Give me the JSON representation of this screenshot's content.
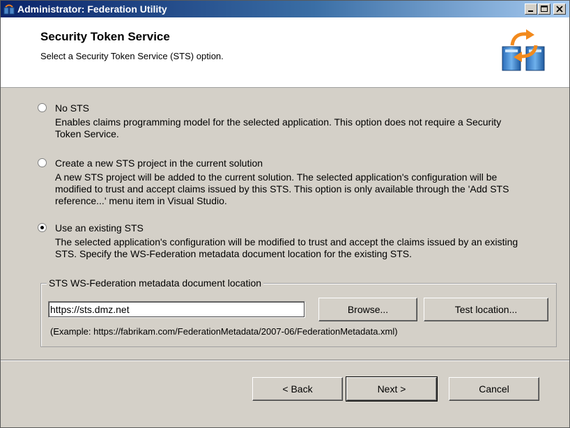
{
  "window": {
    "title": "Administrator: Federation Utility"
  },
  "header": {
    "title": "Security Token Service",
    "subtitle": "Select a Security Token Service (STS) option.",
    "icon": "federation-servers-sync-icon"
  },
  "options": [
    {
      "label": "No STS",
      "description": "Enables claims programming model for the selected application. This option does not require a Security Token Service.",
      "selected": false
    },
    {
      "label": "Create a new STS project in the current solution",
      "description": "A new STS project will be added to the current solution. The selected application's configuration will be modified to trust and accept claims issued by this STS. This option is only available through the 'Add STS reference...' menu item in Visual Studio.",
      "selected": false
    },
    {
      "label": "Use an existing STS",
      "description": "The selected application's configuration will be modified to trust and accept the claims issued by an existing STS. Specify the WS-Federation metadata document location for the existing STS.",
      "selected": true
    }
  ],
  "metadata": {
    "group_label": "STS WS-Federation metadata document location",
    "value": "https://sts.dmz.net",
    "browse_label": "Browse...",
    "test_label": "Test location...",
    "example": "(Example: https://fabrikam.com/FederationMetadata/2007-06/FederationMetadata.xml)"
  },
  "footer": {
    "back_label": "< Back",
    "next_label": "Next >",
    "cancel_label": "Cancel"
  }
}
